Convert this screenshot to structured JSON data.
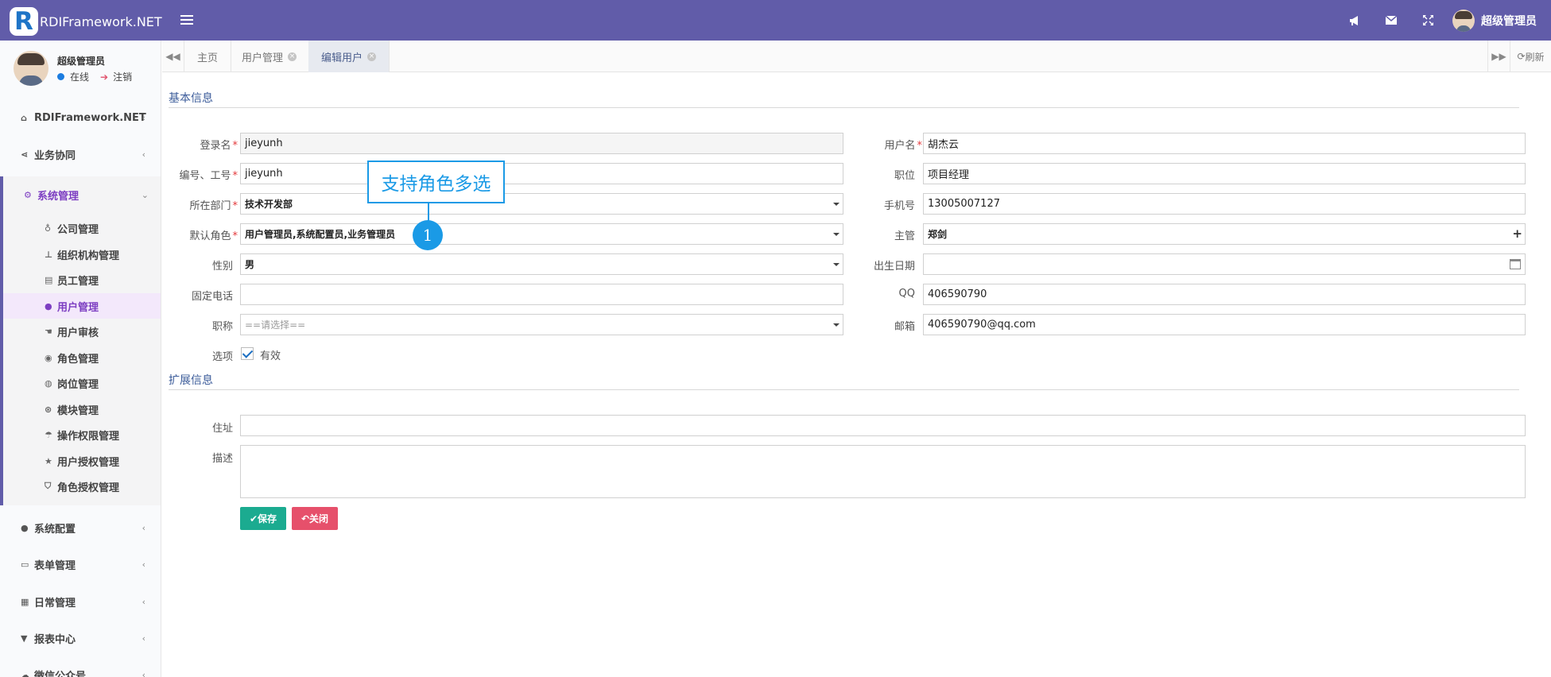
{
  "app": {
    "logo_letter": "R",
    "name": "RDIFramework.NET",
    "top_user": "超级管理员",
    "icons": [
      "bullhorn-icon",
      "envelope-icon",
      "fullscreen-icon"
    ]
  },
  "sidebar": {
    "user_name": "超级管理员",
    "status_online": "在线",
    "logout": "注销",
    "menus": [
      {
        "label": "RDIFramework.NET",
        "icon": "home-icon"
      },
      {
        "label": "业务协同",
        "icon": "share-icon"
      },
      {
        "label": "系统管理",
        "icon": "cogs-icon",
        "expanded": true
      },
      {
        "label": "系统配置",
        "icon": "circle-icon"
      },
      {
        "label": "表单管理",
        "icon": "form-icon"
      },
      {
        "label": "日常管理",
        "icon": "calendar-icon"
      },
      {
        "label": "报表中心",
        "icon": "filter-icon"
      },
      {
        "label": "微信公众号",
        "icon": "wechat-icon"
      }
    ],
    "sub_items": [
      {
        "label": "公司管理",
        "icon": "company-icon"
      },
      {
        "label": "组织机构管理",
        "icon": "sitemap-icon"
      },
      {
        "label": "员工管理",
        "icon": "id-card-icon"
      },
      {
        "label": "用户管理",
        "icon": "user-icon",
        "active": true
      },
      {
        "label": "用户审核",
        "icon": "audit-icon"
      },
      {
        "label": "角色管理",
        "icon": "role-icon"
      },
      {
        "label": "岗位管理",
        "icon": "post-icon"
      },
      {
        "label": "模块管理",
        "icon": "module-icon"
      },
      {
        "label": "操作权限管理",
        "icon": "umbrella-icon"
      },
      {
        "label": "用户授权管理",
        "icon": "star-icon"
      },
      {
        "label": "角色授权管理",
        "icon": "shield-icon"
      }
    ]
  },
  "tabs": {
    "items": [
      {
        "label": "主页",
        "closable": false
      },
      {
        "label": "用户管理",
        "closable": true
      },
      {
        "label": "编辑用户",
        "closable": true,
        "active": true
      }
    ],
    "refresh": "刷新"
  },
  "form": {
    "basic_title": "基本信息",
    "ext_title": "扩展信息",
    "login_label": "登录名",
    "login_value": "jieyunh",
    "code_label": "编号、工号",
    "code_value": "jieyunh",
    "dept_label": "所在部门",
    "dept_value": "技术开发部",
    "role_label": "默认角色",
    "role_value": "用户管理员,系统配置员,业务管理员",
    "gender_label": "性别",
    "gender_value": "男",
    "phone_label": "固定电话",
    "phone_value": "",
    "title_label": "职称",
    "title_placeholder": "==请选择==",
    "options_label": "选项",
    "valid_label": "有效",
    "valid_checked": true,
    "username_label": "用户名",
    "username_value": "胡杰云",
    "position_label": "职位",
    "position_value": "项目经理",
    "mobile_label": "手机号",
    "mobile_value": "13005007127",
    "manager_label": "主管",
    "manager_value": "郑剑",
    "birth_label": "出生日期",
    "birth_value": "",
    "qq_label": "QQ",
    "qq_value": "406590790",
    "email_label": "邮箱",
    "email_value": "406590790@qq.com",
    "address_label": "住址",
    "address_value": "",
    "desc_label": "描述",
    "desc_value": "",
    "save_label": "保存",
    "close_label": "关闭"
  },
  "callout": {
    "text": "支持角色多选",
    "number": "1"
  },
  "colors": {
    "topbar": "#615ca9",
    "accent_blue": "#1a9ae6",
    "save": "#1bab90",
    "close": "#e6506b",
    "active_menu": "#7d3ec2"
  }
}
